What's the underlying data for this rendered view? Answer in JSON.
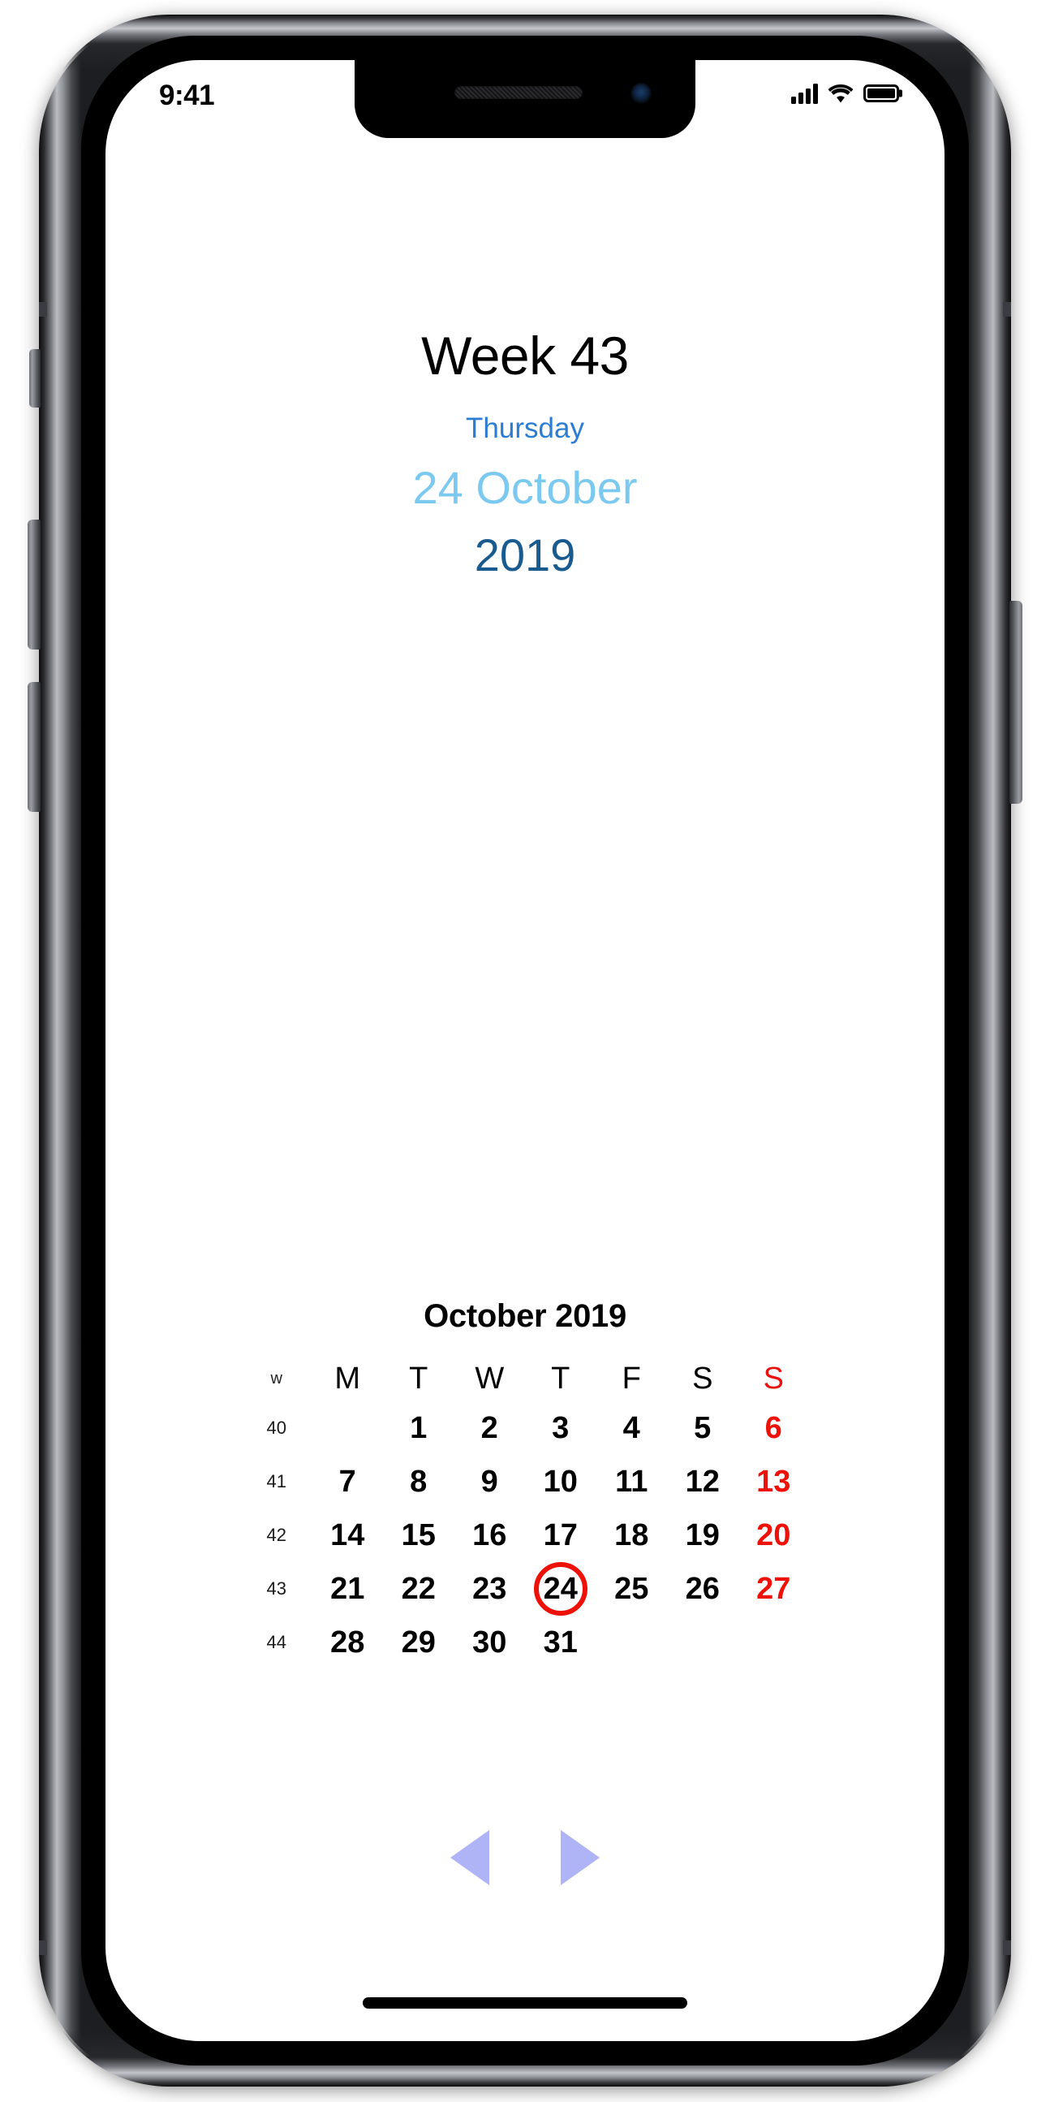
{
  "status_bar": {
    "time": "9:41",
    "cellular_icon": "cellular-signal-icon",
    "wifi_icon": "wifi-icon",
    "battery_icon": "battery-full-icon"
  },
  "header": {
    "week_title": "Week 43",
    "weekday": "Thursday",
    "day_month": "24 October",
    "year": "2019",
    "colors": {
      "week_title": "#000000",
      "weekday": "#2b7dd4",
      "day_month": "#7cc9f0",
      "year": "#1a5b8f"
    }
  },
  "calendar": {
    "title": "October 2019",
    "week_column_header": "w",
    "day_headers": [
      "M",
      "T",
      "W",
      "T",
      "F",
      "S",
      "S"
    ],
    "sunday_color": "#ee1108",
    "today": "24",
    "today_highlight_color": "#ee1108",
    "weeks": [
      {
        "week": "40",
        "days": [
          "",
          "1",
          "2",
          "3",
          "4",
          "5",
          "6"
        ]
      },
      {
        "week": "41",
        "days": [
          "7",
          "8",
          "9",
          "10",
          "11",
          "12",
          "13"
        ]
      },
      {
        "week": "42",
        "days": [
          "14",
          "15",
          "16",
          "17",
          "18",
          "19",
          "20"
        ]
      },
      {
        "week": "43",
        "days": [
          "21",
          "22",
          "23",
          "24",
          "25",
          "26",
          "27"
        ]
      },
      {
        "week": "44",
        "days": [
          "28",
          "29",
          "30",
          "31",
          "",
          "",
          ""
        ]
      }
    ]
  },
  "navigation": {
    "previous_icon": "triangle-left-icon",
    "next_icon": "triangle-right-icon",
    "arrow_color": "#aeb4f5"
  },
  "device": {
    "notch_speaker": "speaker-grille",
    "notch_camera": "front-camera",
    "home_indicator": "home-indicator"
  }
}
